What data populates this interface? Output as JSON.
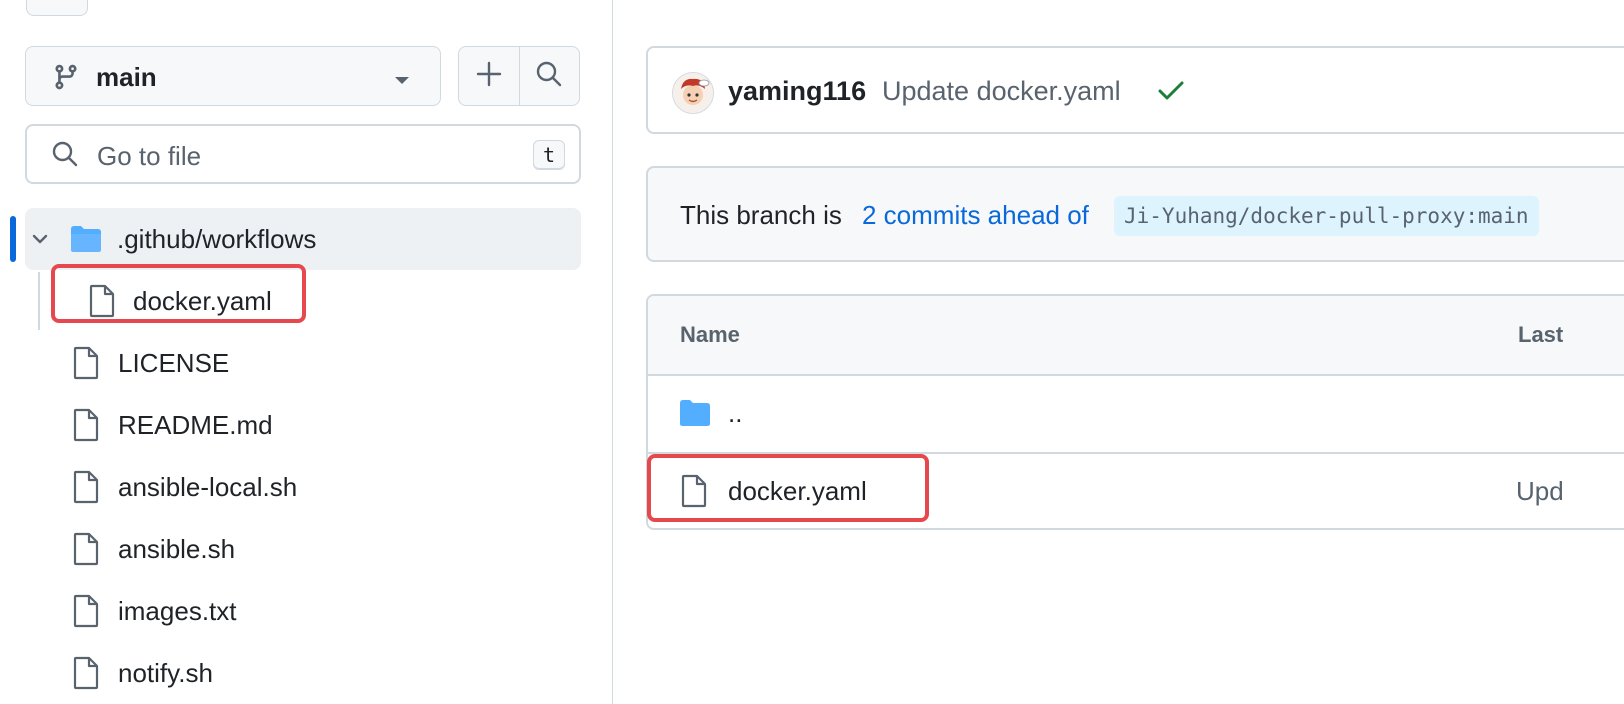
{
  "sidebar": {
    "branch": {
      "name": "main",
      "icon": "git-branch-icon"
    },
    "actions": {
      "add_icon": "plus-icon",
      "search_icon": "search-icon"
    },
    "go_to_file": {
      "placeholder": "Go to file",
      "shortcut": "t"
    },
    "tree": [
      {
        "label": ".github/workflows",
        "type": "folder",
        "expanded": true,
        "icon": "folder-icon"
      },
      {
        "label": "docker.yaml",
        "type": "file",
        "icon": "file-icon",
        "highlighted": true
      },
      {
        "label": "LICENSE",
        "type": "file",
        "icon": "file-icon"
      },
      {
        "label": "README.md",
        "type": "file",
        "icon": "file-icon"
      },
      {
        "label": "ansible-local.sh",
        "type": "file",
        "icon": "file-icon"
      },
      {
        "label": "ansible.sh",
        "type": "file",
        "icon": "file-icon"
      },
      {
        "label": "images.txt",
        "type": "file",
        "icon": "file-icon"
      },
      {
        "label": "notify.sh",
        "type": "file",
        "icon": "file-icon"
      }
    ]
  },
  "commit": {
    "author": "yaming116",
    "message": "Update docker.yaml",
    "status": "success"
  },
  "branch_status": {
    "prefix": "This branch is",
    "link": "2 commits ahead of",
    "ref": "Ji-Yuhang/docker-pull-proxy:main"
  },
  "file_table": {
    "headers": {
      "name": "Name",
      "last": "Last"
    },
    "rows": [
      {
        "name": "..",
        "type": "parent-folder",
        "message": ""
      },
      {
        "name": "docker.yaml",
        "type": "file",
        "message": "Upd",
        "highlighted": true
      }
    ]
  },
  "colors": {
    "accent": "#0969da",
    "folder": "#54aeff",
    "success": "#1a7f37",
    "highlight_box": "#e5484d",
    "border": "#d1d9e0",
    "muted_text": "#59636e"
  }
}
